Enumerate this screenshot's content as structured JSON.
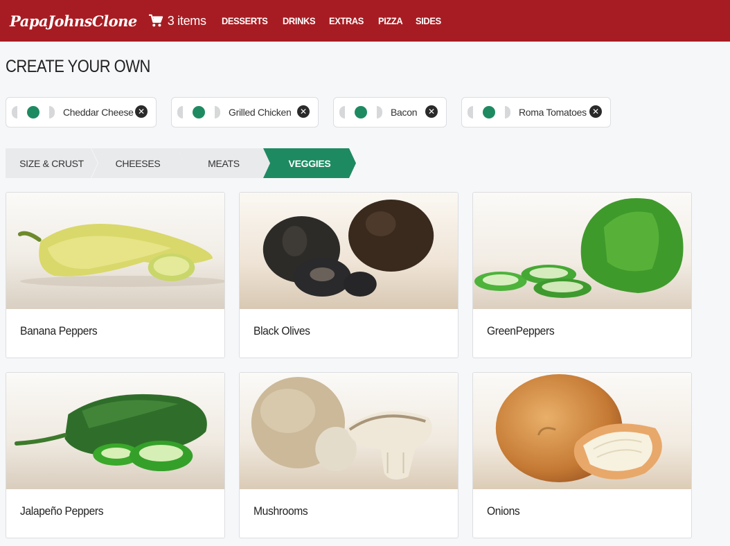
{
  "header": {
    "brand": "PapaJohnsClone",
    "cart_label": "3 items",
    "nav": [
      "DESSERTS",
      "DRINKS",
      "EXTRAS",
      "PIZZA",
      "SIDES"
    ],
    "brand_color": "#a71c22"
  },
  "page_title": "CREATE YOUR OWN",
  "selected_toppings": [
    {
      "label": "Cheddar Cheese",
      "icon": "close-icon"
    },
    {
      "label": "Grilled Chicken",
      "icon": "close-icon"
    },
    {
      "label": "Bacon",
      "icon": "close-icon"
    },
    {
      "label": "Roma Tomatoes",
      "icon": "close-icon"
    }
  ],
  "steps": [
    {
      "label": "SIZE & CRUST",
      "active": false
    },
    {
      "label": "CHEESES",
      "active": false
    },
    {
      "label": "MEATS",
      "active": false
    },
    {
      "label": "VEGGIES",
      "active": true
    }
  ],
  "accent_color": "#1e8a62",
  "products": [
    {
      "name": "Banana Peppers"
    },
    {
      "name": "Black Olives"
    },
    {
      "name": "GreenPeppers"
    },
    {
      "name": "Jalapeño Peppers"
    },
    {
      "name": "Mushrooms"
    },
    {
      "name": "Onions"
    }
  ]
}
